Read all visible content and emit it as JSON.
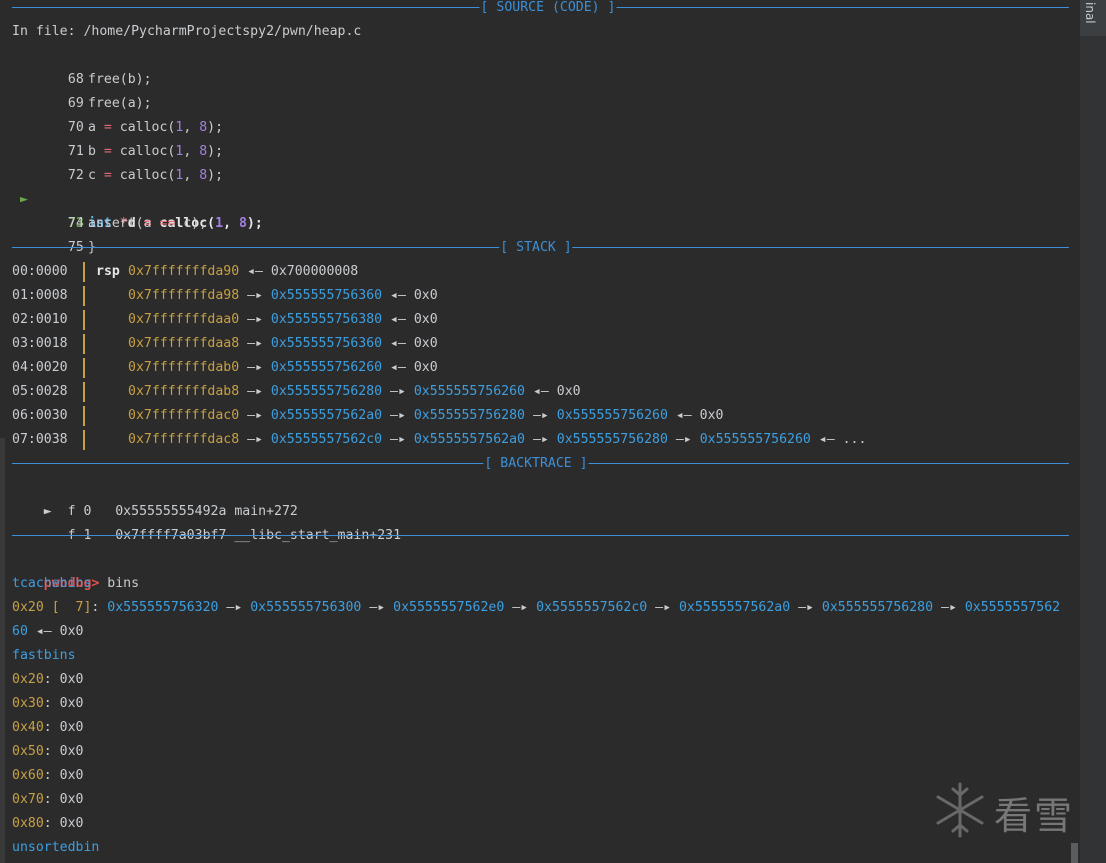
{
  "headers": {
    "source": "[ SOURCE (CODE) ]",
    "stack": "[ STACK ]",
    "backtrace": "[ BACKTRACE ]"
  },
  "source": {
    "file_line": "In file: /home/PycharmProjectspy2/pwn/heap.c",
    "current_marker": "►",
    "lines": [
      {
        "num": "68",
        "code": "free(b);"
      },
      {
        "num": "69",
        "code": "free(a);"
      },
      {
        "num": "70",
        "code": "a = calloc(1, 8);"
      },
      {
        "num": "71",
        "code": "b = calloc(1, 8);"
      },
      {
        "num": "72",
        "code": "c = calloc(1, 8);"
      },
      {
        "num": "73",
        "code": "int *d = calloc(1, 8);"
      },
      {
        "num": "74",
        "code": "assert(a == c);"
      },
      {
        "num": "75",
        "code": "}"
      }
    ],
    "code_tokens": {
      "l70": [
        "a ",
        "=",
        " calloc(",
        "1",
        ", ",
        "8",
        ");"
      ],
      "l73": [
        "int",
        " ",
        "*",
        "d ",
        "=",
        " calloc(",
        "1",
        ", ",
        "8",
        ");"
      ],
      "l74": [
        "assert(a ",
        "==",
        " c);"
      ]
    }
  },
  "stack": {
    "rows": [
      {
        "off": "00:0000",
        "reg": "rsp",
        "addr": "0x7fffffffda90",
        "chain": [
          [
            "w",
            " ◂— 0x700000008"
          ]
        ]
      },
      {
        "off": "01:0008",
        "reg": "",
        "addr": "0x7fffffffda98",
        "chain": [
          [
            "w",
            " —▸ "
          ],
          [
            "b",
            "0x555555756360"
          ],
          [
            "w",
            " ◂— 0x0"
          ]
        ]
      },
      {
        "off": "02:0010",
        "reg": "",
        "addr": "0x7fffffffdaa0",
        "chain": [
          [
            "w",
            " —▸ "
          ],
          [
            "b",
            "0x555555756380"
          ],
          [
            "w",
            " ◂— 0x0"
          ]
        ]
      },
      {
        "off": "03:0018",
        "reg": "",
        "addr": "0x7fffffffdaa8",
        "chain": [
          [
            "w",
            " —▸ "
          ],
          [
            "b",
            "0x555555756360"
          ],
          [
            "w",
            " ◂— 0x0"
          ]
        ]
      },
      {
        "off": "04:0020",
        "reg": "",
        "addr": "0x7fffffffdab0",
        "chain": [
          [
            "w",
            " —▸ "
          ],
          [
            "b",
            "0x555555756260"
          ],
          [
            "w",
            " ◂— 0x0"
          ]
        ]
      },
      {
        "off": "05:0028",
        "reg": "",
        "addr": "0x7fffffffdab8",
        "chain": [
          [
            "w",
            " —▸ "
          ],
          [
            "b",
            "0x555555756280"
          ],
          [
            "w",
            " —▸ "
          ],
          [
            "b",
            "0x555555756260"
          ],
          [
            "w",
            " ◂— 0x0"
          ]
        ]
      },
      {
        "off": "06:0030",
        "reg": "",
        "addr": "0x7fffffffdac0",
        "chain": [
          [
            "w",
            " —▸ "
          ],
          [
            "b",
            "0x5555557562a0"
          ],
          [
            "w",
            " —▸ "
          ],
          [
            "b",
            "0x555555756280"
          ],
          [
            "w",
            " —▸ "
          ],
          [
            "b",
            "0x555555756260"
          ],
          [
            "w",
            " ◂— 0x0"
          ]
        ]
      },
      {
        "off": "07:0038",
        "reg": "",
        "addr": "0x7fffffffdac8",
        "chain": [
          [
            "w",
            " —▸ "
          ],
          [
            "b",
            "0x5555557562c0"
          ],
          [
            "w",
            " —▸ "
          ],
          [
            "b",
            "0x5555557562a0"
          ],
          [
            "w",
            " —▸ "
          ],
          [
            "b",
            "0x555555756280"
          ],
          [
            "w",
            " —▸ "
          ],
          [
            "b",
            "0x555555756260"
          ],
          [
            "w",
            " ◂— ..."
          ]
        ]
      }
    ]
  },
  "backtrace": {
    "marker": "►",
    "frames": [
      {
        "text": "f 0   0x55555555492a main+272"
      },
      {
        "text": "f 1   0x7ffff7a03bf7 __libc_start_main+231"
      }
    ]
  },
  "bins": {
    "prompt": "pwndbg>",
    "command": "bins",
    "tcache_title": "tcachebins",
    "tcache_line1": [
      [
        "y",
        "0x20 [  7]"
      ],
      [
        "w",
        ": "
      ],
      [
        "b",
        "0x555555756320"
      ],
      [
        "w",
        " —▸ "
      ],
      [
        "b",
        "0x555555756300"
      ],
      [
        "w",
        " —▸ "
      ],
      [
        "b",
        "0x5555557562e0"
      ],
      [
        "w",
        " —▸ "
      ],
      [
        "b",
        "0x5555557562c0"
      ],
      [
        "w",
        " —▸ "
      ],
      [
        "b",
        "0x5555557562a0"
      ],
      [
        "w",
        " —▸ "
      ],
      [
        "b",
        "0x555555756280"
      ],
      [
        "w",
        " —▸ "
      ],
      [
        "b",
        "0x5555557562"
      ]
    ],
    "tcache_line2": [
      [
        "b",
        "60"
      ],
      [
        "w",
        " ◂— 0x0"
      ]
    ],
    "fast_title": "fastbins",
    "fast": [
      {
        "size": "0x20",
        "val": ": 0x0"
      },
      {
        "size": "0x30",
        "val": ": 0x0"
      },
      {
        "size": "0x40",
        "val": ": 0x0"
      },
      {
        "size": "0x50",
        "val": ": 0x0"
      },
      {
        "size": "0x60",
        "val": ": 0x0"
      },
      {
        "size": "0x70",
        "val": ": 0x0"
      },
      {
        "size": "0x80",
        "val": ": 0x0"
      }
    ],
    "unsorted_title": "unsortedbin"
  },
  "side_tab": {
    "label": "inal"
  },
  "watermark": {
    "text": "看雪"
  },
  "colors": {
    "rule": "#3d8fd6",
    "address_stack": "#c8a043",
    "address_heap": "#3d9fe0",
    "prompt": "#e05252",
    "current_line": "#6aa84f"
  }
}
